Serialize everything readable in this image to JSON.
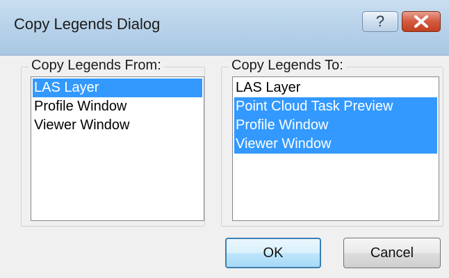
{
  "window": {
    "title": "Copy Legends Dialog",
    "help_label": "?",
    "close_icon": "close-x-icon"
  },
  "from_group": {
    "label": "Copy Legends From:",
    "items": [
      {
        "label": "LAS Layer",
        "selected": true
      },
      {
        "label": "Profile Window",
        "selected": false
      },
      {
        "label": "Viewer Window",
        "selected": false
      }
    ]
  },
  "to_group": {
    "label": "Copy Legends To:",
    "items": [
      {
        "label": "LAS Layer",
        "selected": false
      },
      {
        "label": "Point Cloud Task Preview",
        "selected": true
      },
      {
        "label": "Profile Window",
        "selected": true
      },
      {
        "label": "Viewer Window",
        "selected": true
      }
    ]
  },
  "buttons": {
    "ok_label": "OK",
    "cancel_label": "Cancel"
  },
  "colors": {
    "selection": "#3399ff",
    "close_button": "#c2401f",
    "titlebar": "#b9d3ea"
  }
}
